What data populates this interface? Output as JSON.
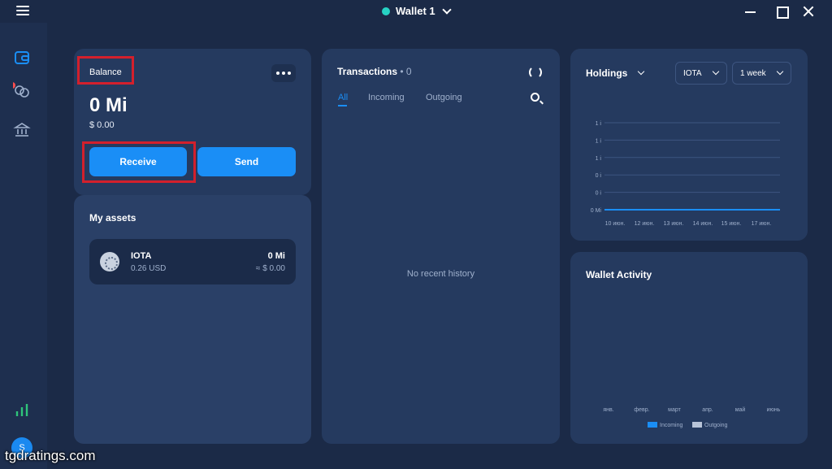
{
  "titlebar": {
    "wallet_name": "Wallet 1",
    "wallet_color": "#27d2c4",
    "icons": [
      "hamburger-icon",
      "minimize-icon",
      "maximize-icon",
      "close-icon"
    ]
  },
  "sidebar": {
    "items": [
      {
        "icon": "wallet-icon",
        "active": true
      },
      {
        "icon": "staking-icon",
        "badge": true
      },
      {
        "icon": "bank-icon"
      },
      {
        "icon": "chart-icon"
      }
    ],
    "avatar_initial": "S"
  },
  "balance": {
    "label": "Balance",
    "amount": "0 Mi",
    "fiat": "$ 0.00",
    "receive_label": "Receive",
    "send_label": "Send"
  },
  "assets": {
    "title": "My assets",
    "items": [
      {
        "name": "IOTA",
        "price": "0.26 USD",
        "amount": "0 Mi",
        "fiat": "≈ $ 0.00"
      }
    ]
  },
  "transactions": {
    "title": "Transactions",
    "count": "• 0",
    "tabs": [
      "All",
      "Incoming",
      "Outgoing"
    ],
    "empty_text": "No recent history"
  },
  "holdings": {
    "title": "Holdings",
    "asset_select": "IOTA",
    "range_select": "1 week",
    "chart_data": {
      "type": "line",
      "title": "",
      "y_tick_labels": [
        "1 i",
        "1 i",
        "1 i",
        "0 i",
        "0 i",
        "0 Mi"
      ],
      "x_tick_labels": [
        "10 июн.",
        "12 июн.",
        "13 июн.",
        "14 июн.",
        "15 июн.",
        "17 июн."
      ],
      "series": [
        {
          "values": [
            0,
            0,
            0,
            0,
            0,
            0
          ]
        }
      ],
      "line_color": "#1a8ef6"
    }
  },
  "activity": {
    "title": "Wallet Activity",
    "chart_data": {
      "type": "bar",
      "categories": [
        "янв.",
        "февр.",
        "март",
        "апр.",
        "май",
        "июнь"
      ],
      "series": [
        {
          "name": "Incoming",
          "color": "#1a8ef6",
          "values": [
            0,
            0,
            0,
            0,
            0,
            0
          ]
        },
        {
          "name": "Outgoing",
          "color": "#b8c4d8",
          "values": [
            0,
            0,
            0,
            0,
            0,
            0
          ]
        }
      ]
    }
  },
  "watermark": "tgdratings.com",
  "colors": {
    "accent": "#1a8ef6",
    "highlight": "#d3202c"
  }
}
